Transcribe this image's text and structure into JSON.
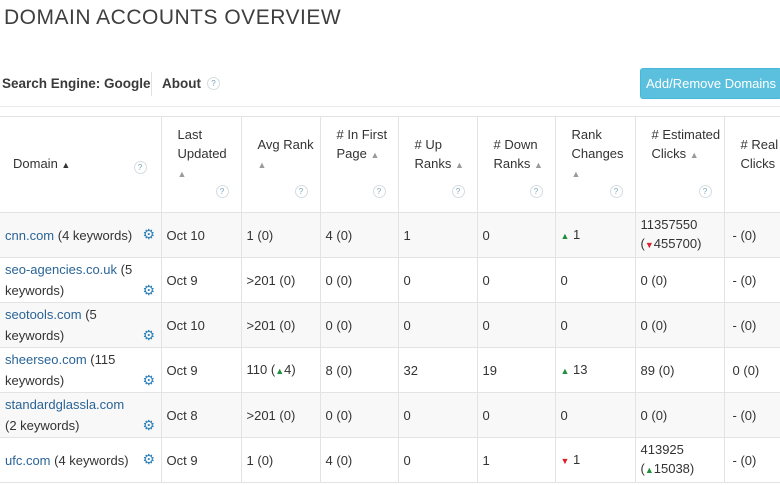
{
  "title": "DOMAIN ACCOUNTS OVERVIEW",
  "toolbar": {
    "search_engine": "Search Engine: Google",
    "about": "About",
    "help": "?",
    "add_button": "Add/Remove Domains"
  },
  "columns": {
    "domain": "Domain",
    "last_updated": "Last Updated",
    "avg_rank": "Avg Rank",
    "in_first_page": "# In First Page",
    "up_ranks": "# Up Ranks",
    "down_ranks": "# Down Ranks",
    "rank_changes": "Rank Changes",
    "estimated_clicks": "# Estimated Clicks",
    "real_clicks": "# Real Clicks",
    "sort_icon": "▲",
    "help": "?"
  },
  "rows": [
    {
      "domain": "cnn.com",
      "keywords": " (4 keywords)",
      "updated": "Oct 10",
      "avg": "1",
      "avg_chg": "(0)",
      "first": "4",
      "first_chg": "(0)",
      "up": "1",
      "down": "0",
      "change": "1",
      "change_dir": "▲",
      "clicks": "11357550",
      "clicks_dir": "▼",
      "clicks_chg": "455700",
      "real": "-",
      "real_chg": "(0)"
    },
    {
      "domain": "seo-agencies.co.uk",
      "keywords": " (5 keywords)",
      "updated": "Oct 9",
      "avg": ">201",
      "avg_chg": "(0)",
      "first": "0",
      "first_chg": "(0)",
      "up": "0",
      "down": "0",
      "change": "0",
      "change_dir": "",
      "clicks": "0",
      "clicks_paren": "(0)",
      "real": "-",
      "real_chg": "(0)"
    },
    {
      "domain": "seotools.com",
      "keywords": " (5 keywords)",
      "updated": "Oct 10",
      "avg": ">201",
      "avg_chg": "(0)",
      "first": "0",
      "first_chg": "(0)",
      "up": "0",
      "down": "0",
      "change": "0",
      "change_dir": "",
      "clicks": "0",
      "clicks_paren": "(0)",
      "real": "-",
      "real_chg": "(0)"
    },
    {
      "domain": "sheerseo.com",
      "keywords": " (115 keywords)",
      "updated": "Oct 9",
      "avg": "110",
      "avg_dir": "▲",
      "avg_val": "4",
      "first": "8",
      "first_chg": "(0)",
      "up": "32",
      "down": "19",
      "change": "13",
      "change_dir": "▲",
      "clicks": "89",
      "clicks_paren": "(0)",
      "real": "0",
      "real_chg": "(0)"
    },
    {
      "domain": "standardglassla.com",
      "keywords": " (2 keywords)",
      "updated": "Oct 8",
      "avg": ">201",
      "avg_chg": "(0)",
      "first": "0",
      "first_chg": "(0)",
      "up": "0",
      "down": "0",
      "change": "0",
      "change_dir": "",
      "clicks": "0",
      "clicks_paren": "(0)",
      "real": "-",
      "real_chg": "(0)"
    },
    {
      "domain": "ufc.com",
      "keywords": " (4 keywords)",
      "updated": "Oct 9",
      "avg": "1",
      "avg_chg": "(0)",
      "first": "4",
      "first_chg": "(0)",
      "up": "0",
      "down": "1",
      "change": "1",
      "change_dir": "▼",
      "clicks": "413925",
      "clicks_dir": "▲",
      "clicks_chg": "15038",
      "real": "-",
      "real_chg": "(0)"
    }
  ]
}
